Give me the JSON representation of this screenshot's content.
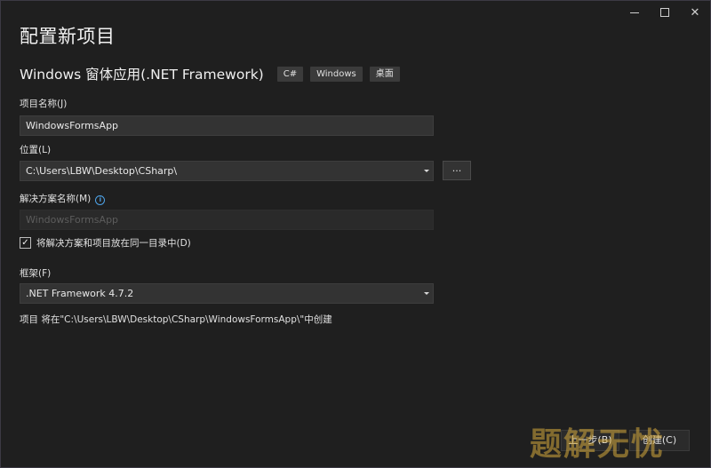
{
  "window": {
    "controls": {
      "minimize": "—",
      "maximize": "□",
      "close": "✕"
    }
  },
  "header": {
    "title": "配置新项目",
    "template_name": "Windows 窗体应用(.NET Framework)",
    "tags": [
      "C#",
      "Windows",
      "桌面"
    ]
  },
  "form": {
    "project_name": {
      "label": "项目名称(J)",
      "value": "WindowsFormsApp"
    },
    "location": {
      "label": "位置(L)",
      "value": "C:\\Users\\LBW\\Desktop\\CSharp\\",
      "browse_label": "..."
    },
    "solution_name": {
      "label": "解决方案名称(M)",
      "value": "WindowsFormsApp",
      "info_icon": "i"
    },
    "same_dir": {
      "checked": true,
      "check_glyph": "✓",
      "label": "将解决方案和项目放在同一目录中(D)"
    },
    "framework": {
      "label": "框架(F)",
      "value": ".NET Framework 4.7.2"
    },
    "info_text": "项目 将在\"C:\\Users\\LBW\\Desktop\\CSharp\\WindowsFormsApp\\\"中创建"
  },
  "footer": {
    "back_label": "上一步(B)",
    "create_label": "创建(C)"
  },
  "watermark": "题解无忧"
}
